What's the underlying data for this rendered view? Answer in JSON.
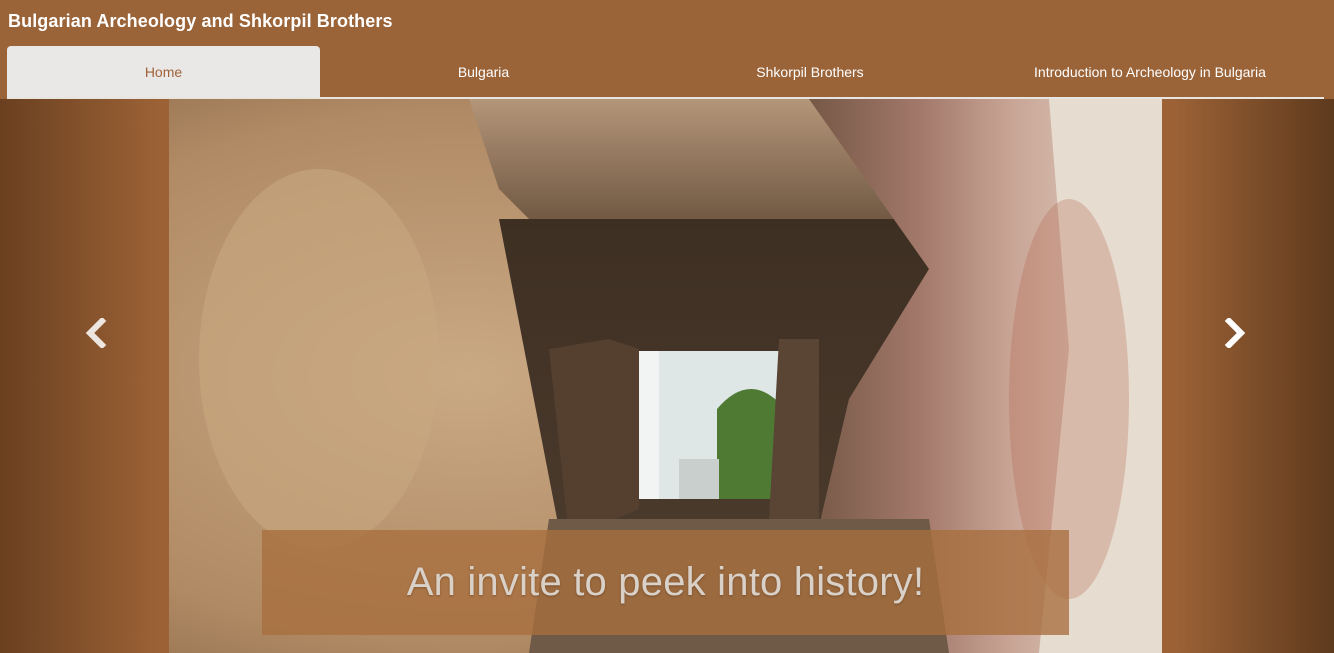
{
  "header": {
    "site_title": "Bulgarian Archeology and Shkorpil Brothers"
  },
  "nav": {
    "items": [
      {
        "label": "Home",
        "active": true
      },
      {
        "label": "Bulgaria",
        "active": false
      },
      {
        "label": "Shkorpil Brothers",
        "active": false
      },
      {
        "label": "Introduction to Archeology in Bulgaria",
        "active": false
      }
    ]
  },
  "carousel": {
    "caption": "An invite to peek into history!",
    "prev_icon": "chevron-left-icon",
    "next_icon": "chevron-right-icon",
    "slide_image": "stone-wall-window-photo"
  },
  "colors": {
    "header_bg": "#9a6338",
    "active_tab_bg": "#e9e8e7",
    "active_tab_text": "#a0623a",
    "caption_bg": "#a86e3e"
  }
}
